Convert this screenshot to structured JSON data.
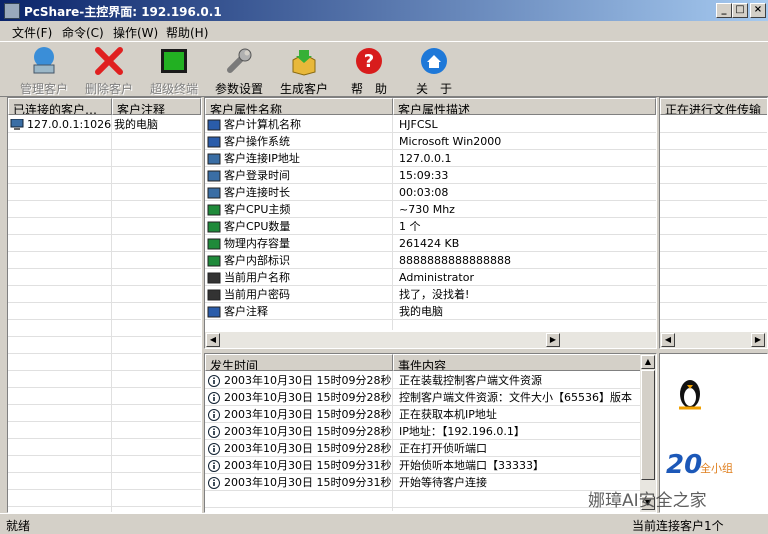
{
  "window": {
    "title": "PcShare-主控界面: 192.196.0.1",
    "min": "_",
    "max": "□",
    "close": "×"
  },
  "menu": [
    "文件(F)",
    "命令(C)",
    "操作(W)",
    "帮助(H)"
  ],
  "toolbar": [
    {
      "label": "管理客户",
      "icon": "monitor-icon"
    },
    {
      "label": "删除客户",
      "icon": "red-x-icon"
    },
    {
      "label": "超级终端",
      "icon": "terminal-icon"
    },
    {
      "label": "参数设置",
      "icon": "wrench-icon"
    },
    {
      "label": "生成客户",
      "icon": "box-icon"
    },
    {
      "label": "帮　助",
      "icon": "help-icon"
    },
    {
      "label": "关　于",
      "icon": "home-icon"
    }
  ],
  "client_list": {
    "headers": [
      "已连接的客户…",
      "客户注释"
    ],
    "rows": [
      {
        "addr": "127.0.0.1:1026",
        "note": "我的电脑"
      }
    ]
  },
  "properties": {
    "headers": [
      "客户属性名称",
      "客户属性描述"
    ],
    "rows": [
      {
        "name": "客户计算机名称",
        "value": "HJFCSL"
      },
      {
        "name": "客户操作系统",
        "value": "Microsoft Win2000"
      },
      {
        "name": "客户连接IP地址",
        "value": "127.0.0.1"
      },
      {
        "name": "客户登录时间",
        "value": "15:09:33"
      },
      {
        "name": "客户连接时长",
        "value": "00:03:08"
      },
      {
        "name": "客户CPU主频",
        "value": "~730 Mhz"
      },
      {
        "name": "客户CPU数量",
        "value": "1 个"
      },
      {
        "name": "物理内存容量",
        "value": "261424 KB"
      },
      {
        "name": "客户内部标识",
        "value": "8888888888888888"
      },
      {
        "name": "当前用户名称",
        "value": "Administrator"
      },
      {
        "name": "当前用户密码",
        "value": "找了，没找着!"
      },
      {
        "name": "客户注释",
        "value": "我的电脑"
      }
    ]
  },
  "transfer": {
    "header": "正在进行文件传输"
  },
  "log": {
    "headers": [
      "发生时间",
      "事件内容"
    ],
    "rows": [
      {
        "time": "2003年10月30日 15时09分28秒",
        "event": "正在装载控制客户端文件资源"
      },
      {
        "time": "2003年10月30日 15时09分28秒",
        "event": "控制客户端文件资源：文件大小【65536】版本"
      },
      {
        "time": "2003年10月30日 15时09分28秒",
        "event": "正在获取本机IP地址"
      },
      {
        "time": "2003年10月30日 15时09分28秒",
        "event": "IP地址：【192.196.0.1】"
      },
      {
        "time": "2003年10月30日 15时09分28秒",
        "event": "正在打开侦听端口"
      },
      {
        "time": "2003年10月30日 15时09分31秒",
        "event": "开始侦听本地端口【33333】"
      },
      {
        "time": "2003年10月30日 15时09分31秒",
        "event": "开始等待客户连接"
      }
    ]
  },
  "status": {
    "left": "就绪",
    "right": "当前连接客户1个"
  },
  "watermark": "娜璋AI安全之家",
  "colors": {
    "title_start": "#0a246a",
    "title_end": "#a6caf0",
    "face": "#d4d0c8"
  }
}
